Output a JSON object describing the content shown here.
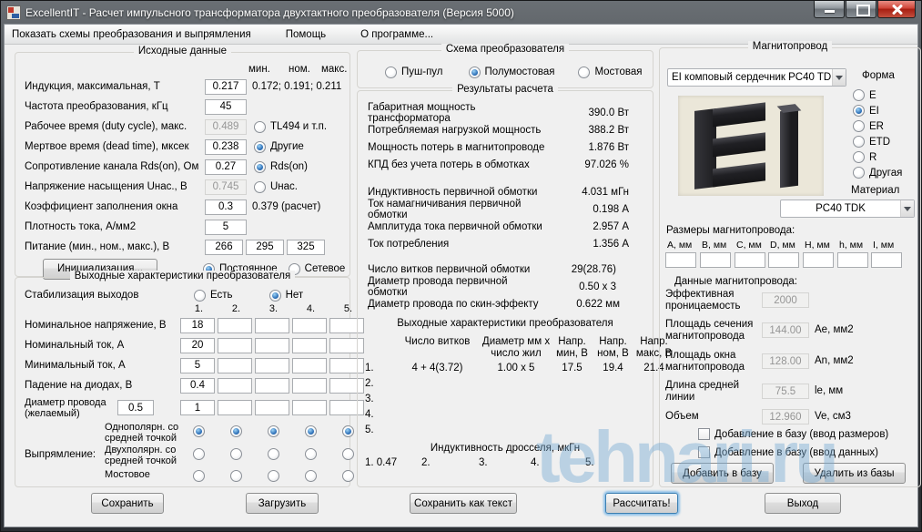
{
  "window": {
    "title": "ExcellentIT - Расчет импульсного трансформатора двухтактного преобразователя (Версия 5000)",
    "menu": [
      "Показать схемы преобразования и выпрямления",
      "Помощь",
      "О программе..."
    ]
  },
  "left": {
    "g1": {
      "title": "Исходные данные",
      "hdr": {
        "min": "мин.",
        "nom": "ном.",
        "max": "макс."
      },
      "r1": {
        "label": "Индукция, максимальная, Т",
        "value": "0.217",
        "note": "0.172; 0.191; 0.211"
      },
      "r2": {
        "label": "Частота преобразования, кГц",
        "value": "45"
      },
      "r3": {
        "label": "Рабочее время (duty cycle), макс.",
        "value": "0.489",
        "radio": "TL494 и т.п."
      },
      "r4": {
        "label": "Мертвое время (dead time), мксек",
        "value": "0.238",
        "radio": "Другие"
      },
      "r5": {
        "label": "Сопротивление канала Rds(on), Ом",
        "value": "0.27",
        "radio": "Rds(on)"
      },
      "r6": {
        "label": "Напряжение насыщения Uнас., В",
        "value": "0.745",
        "radio": "Uнас."
      },
      "r7": {
        "label": "Коэффициент заполнения окна",
        "value": "0.3",
        "note": "0.379 (расчет)"
      },
      "r8": {
        "label": "Плотность тока, А/мм2",
        "value": "5"
      },
      "r9": {
        "label": "Питание (мин., ном., макс.), В",
        "v1": "266",
        "v2": "295",
        "v3": "325"
      },
      "init_btn": "Инициализация...",
      "dc": "Постоянное",
      "ac": "Сетевое"
    },
    "g2": {
      "title": "Выходные характеристики преобразователя",
      "stab_label": "Стабилизация выходов",
      "stab_yes": "Есть",
      "stab_no": "Нет",
      "cols": [
        "1.",
        "2.",
        "3.",
        "4.",
        "5."
      ],
      "r1": {
        "label": "Номинальное напряжение, В",
        "v": "18"
      },
      "r2": {
        "label": "Номинальный ток, А",
        "v": "20"
      },
      "r3": {
        "label": "Минимальный ток, А",
        "v": "5"
      },
      "r4": {
        "label": "Падение на диодах, В",
        "v": "0.4"
      },
      "r5": {
        "label": "Диаметр провода (желаемый)",
        "extra": "0.5",
        "v": "1"
      },
      "rect_label": "Выпрямление:",
      "rect1": "Однополярн. со средней точкой",
      "rect2": "Двухполярн. со средней точкой",
      "rect3": "Мостовое"
    }
  },
  "middle": {
    "scheme": {
      "title": "Схема преобразователя",
      "o1": "Пуш-пул",
      "o2": "Полумостовая",
      "o3": "Мостовая"
    },
    "results": {
      "title": "Результаты расчета",
      "rows1": [
        {
          "label": "Габаритная мощность трансформатора",
          "value": "390.0 Вт"
        },
        {
          "label": "Потребляемая нагрузкой мощность",
          "value": "388.2 Вт"
        },
        {
          "label": "Мощность потерь в магнитопроводе",
          "value": "1.876 Вт"
        },
        {
          "label": "КПД без учета потерь в обмотках",
          "value": "97.026 %"
        }
      ],
      "rows2": [
        {
          "label": "Индуктивность первичной обмотки",
          "value": "4.031 мГн"
        },
        {
          "label": "Ток намагничивания первичной обмотки",
          "value": "0.198 А"
        },
        {
          "label": "Амплитуда тока первичной обмотки",
          "value": "2.957 А"
        },
        {
          "label": "Ток потребления",
          "value": "1.356 А"
        }
      ],
      "rows3": [
        {
          "label": "Число витков первичной обмотки",
          "value": "29(28.76)"
        },
        {
          "label": "Диаметр провода первичной обмотки",
          "value": "0.50 x 3"
        },
        {
          "label": "Диаметр провода по скин-эффекту",
          "value": "0.622 мм"
        }
      ]
    },
    "tbl": {
      "title": "Выходные характеристики преобразователя",
      "h1": "Число витков",
      "h2": "Диаметр мм х число жил",
      "h3": "Напр. мин, В",
      "h4": "Напр. ном, В",
      "h5": "Напр. макс, В",
      "row1": {
        "num": "1.",
        "turns": "4 + 4(3.72)",
        "diam": "1.00 x 5",
        "vmin": "17.5",
        "vnom": "19.4",
        "vmax": "21.4"
      },
      "rows_rest": [
        "2.",
        "3.",
        "4.",
        "5."
      ]
    },
    "choke": {
      "title": "Индуктивность дросселя, мкГн",
      "items": [
        "1. 0.47",
        "2.",
        "3.",
        "4.",
        "5."
      ]
    }
  },
  "right": {
    "title": "Магнитопровод",
    "core_dd": "EI комповый сердечник PC40 TD",
    "shape_label": "Форма",
    "shapes": [
      "E",
      "EI",
      "ER",
      "ETD",
      "R",
      "Другая"
    ],
    "material_label": "Материал",
    "material_dd": "PC40 TDK",
    "dims_label": "Размеры магнитопровода:",
    "dims": [
      "А, мм",
      "В, мм",
      "С, мм",
      "D, мм",
      "Н, мм",
      "h, мм",
      "I, мм"
    ],
    "data_label": "Данные магнитопровода:",
    "d1": {
      "label": "Эффективная проницаемость",
      "value": "2000",
      "unit": ""
    },
    "d2": {
      "label": "Площадь сечения магнитопровода",
      "value": "144.00",
      "unit": "Ae, мм2"
    },
    "d3": {
      "label": "Площадь окна магнитопровода",
      "value": "128.00",
      "unit": "An, мм2"
    },
    "d4": {
      "label": "Длина средней линии",
      "value": "75.5",
      "unit": "le, мм"
    },
    "d5": {
      "label": "Объем",
      "value": "12.960",
      "unit": "Ve, см3"
    },
    "cb1": "Добавление в базу (ввод размеров)",
    "cb2": "Добавление в базу (ввод данных)",
    "btn_add": "Добавить в базу",
    "btn_del": "Удалить из базы"
  },
  "buttons": {
    "save": "Сохранить",
    "load": "Загрузить",
    "save_text": "Сохранить как текст",
    "calc": "Рассчитать!",
    "exit": "Выход"
  },
  "watermark": "tehnari.ru"
}
